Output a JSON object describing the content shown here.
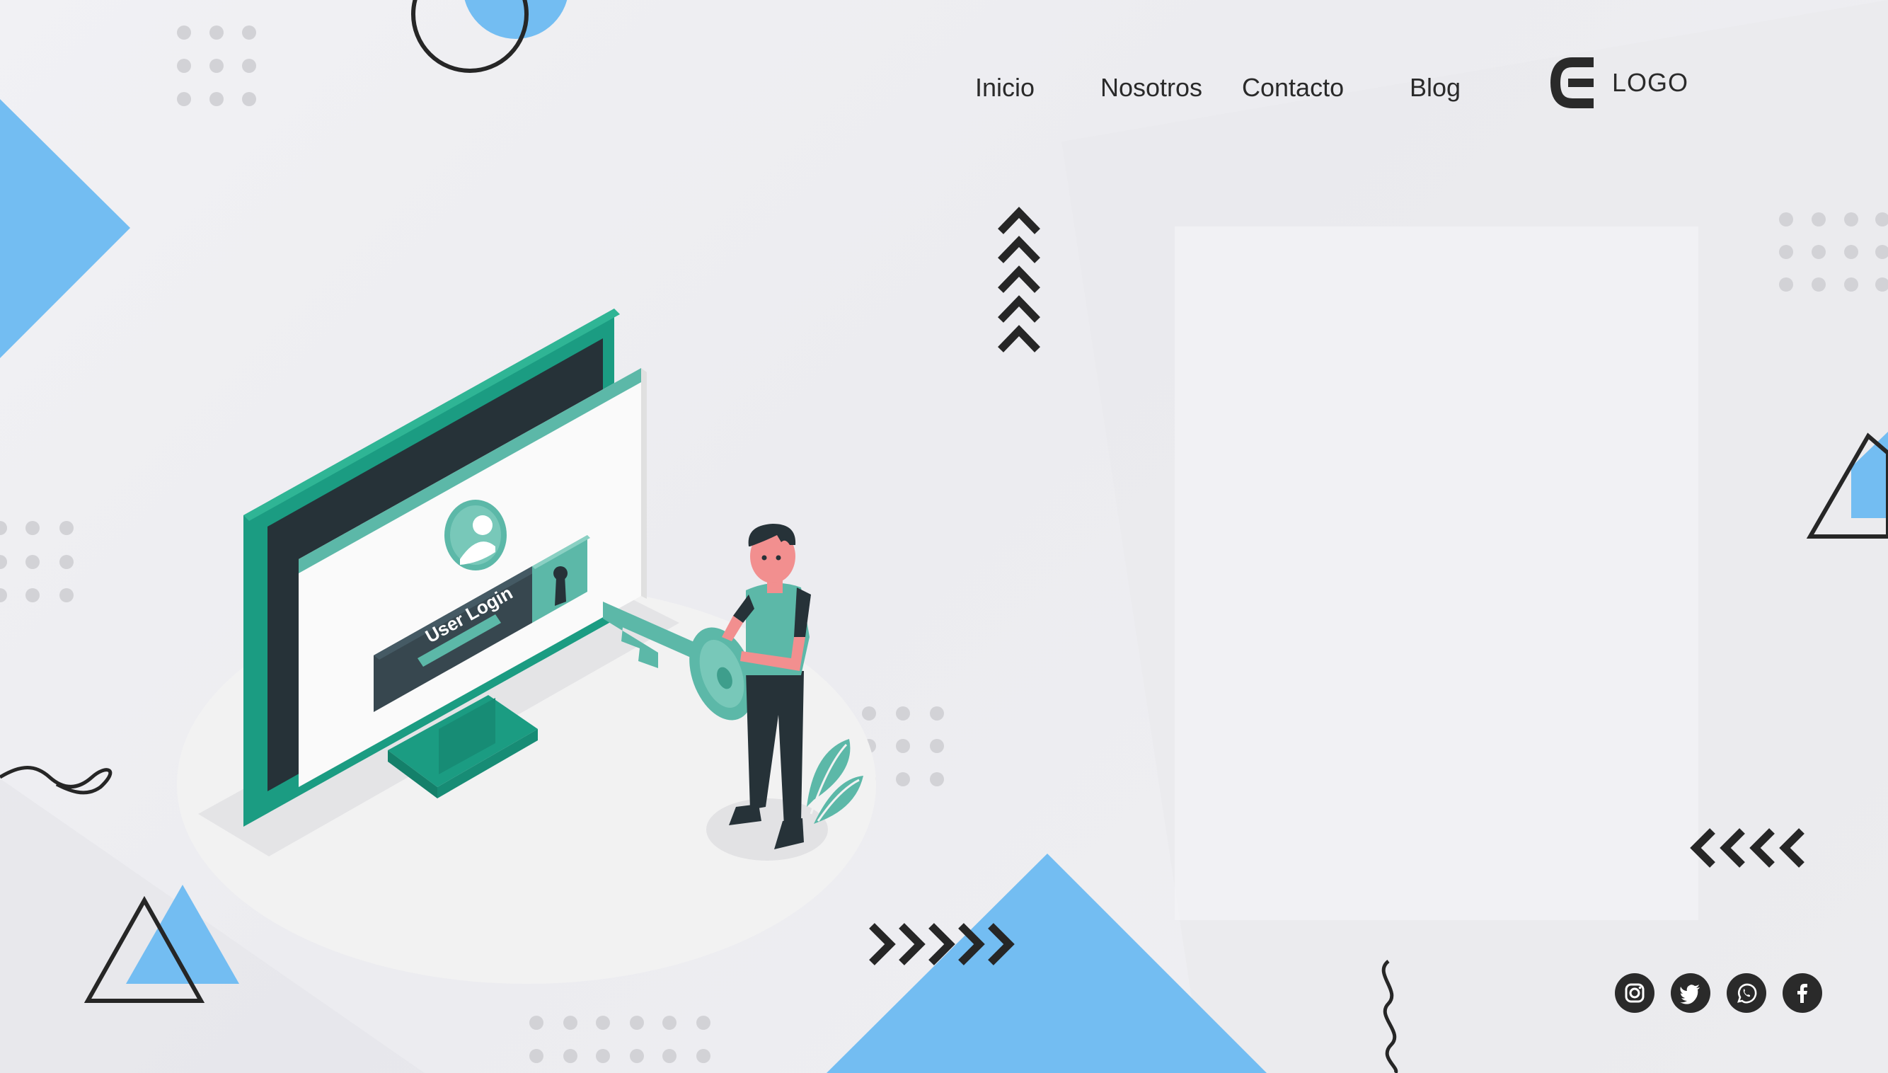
{
  "nav": {
    "items": [
      {
        "label": "Inicio"
      },
      {
        "label": "Nosotros"
      },
      {
        "label": "Contacto"
      },
      {
        "label": "Blog"
      }
    ]
  },
  "brand": {
    "logo_text": "LOGO"
  },
  "illustration": {
    "screen_label": "User Login"
  },
  "social": [
    {
      "icon": "instagram-icon"
    },
    {
      "icon": "twitter-icon"
    },
    {
      "icon": "whatsapp-icon"
    },
    {
      "icon": "facebook-icon"
    }
  ],
  "colors": {
    "accent_blue": "#73bdf2",
    "teal": "#1b9c82",
    "teal_light": "#5cb8a8",
    "dark": "#263238",
    "ink": "#2a2a2a"
  }
}
